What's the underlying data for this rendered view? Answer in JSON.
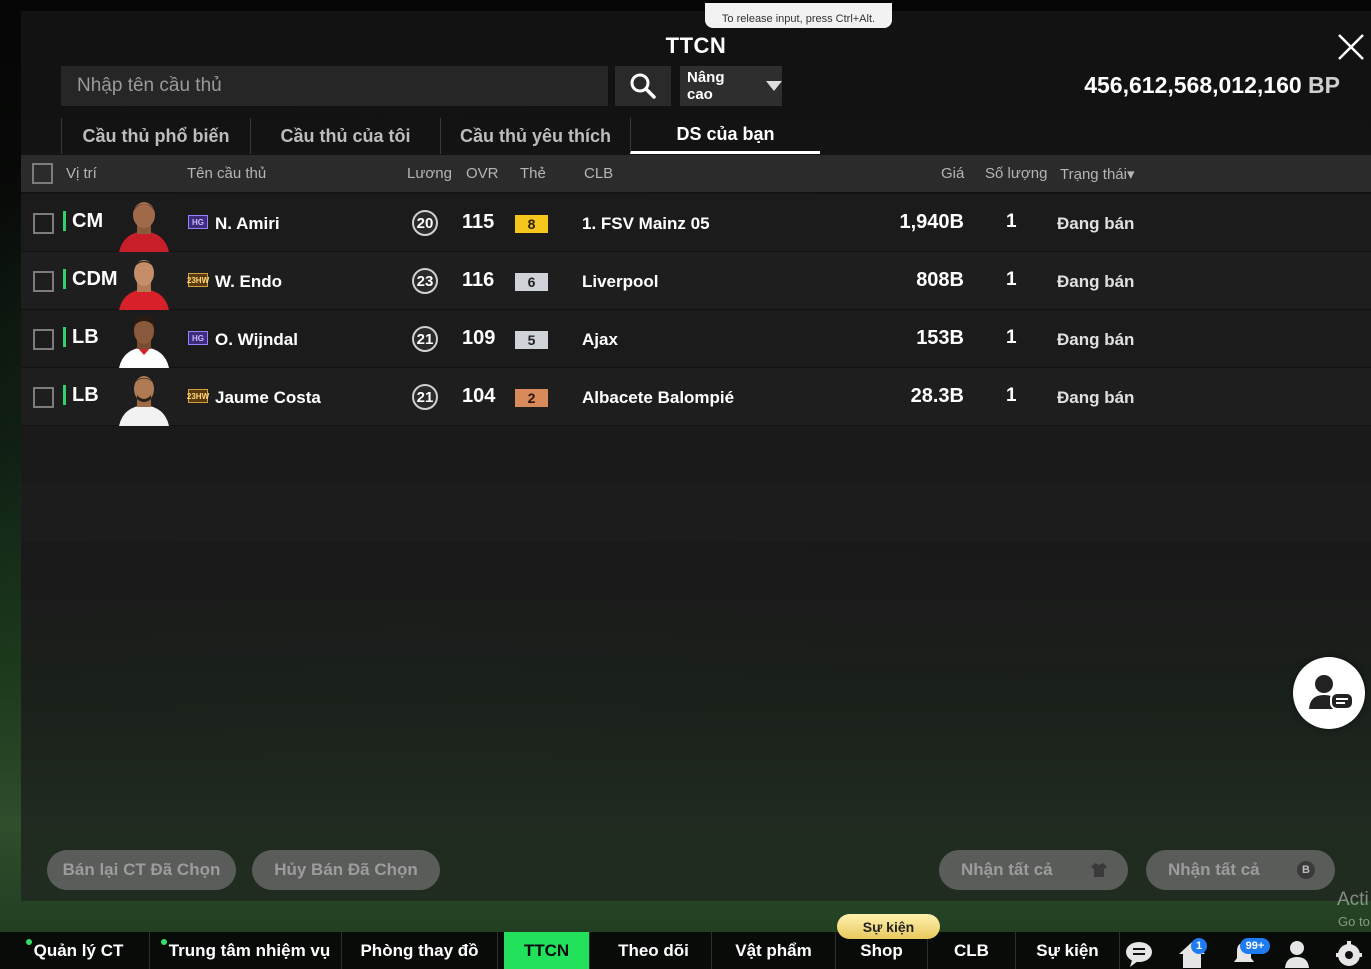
{
  "overlay": {
    "tooltip": "To release input, press Ctrl+Alt."
  },
  "header": {
    "title": "TTCN"
  },
  "search": {
    "placeholder": "Nhập tên cầu thủ",
    "advanced_label": "Nâng cao"
  },
  "currency": {
    "amount": "456,612,568,012,160",
    "unit": "BP"
  },
  "tabs": [
    {
      "label": "Cầu thủ phổ biến"
    },
    {
      "label": "Cầu thủ của tôi"
    },
    {
      "label": "Cầu thủ yêu thích"
    },
    {
      "label": "DS của bạn",
      "active": true
    }
  ],
  "table": {
    "headers": {
      "position": "Vị trí",
      "name": "Tên cầu thủ",
      "salary": "Lương",
      "ovr": "OVR",
      "card": "Thẻ",
      "club": "CLB",
      "price": "Giá",
      "quantity": "Số lượng",
      "status": "Trạng thái▾"
    },
    "rows": [
      {
        "position": "CM",
        "season_badge": "HG",
        "name": "N. Amiri",
        "salary": "20",
        "ovr": "115",
        "upgrade": "8",
        "upgrade_color": "#f5c51c",
        "club": "1. FSV Mainz 05",
        "price": "1,940B",
        "quantity": "1",
        "status": "Đang bán",
        "kit": "#c81e2a"
      },
      {
        "position": "CDM",
        "season_badge": "23HW",
        "name": "W. Endo",
        "salary": "23",
        "ovr": "116",
        "upgrade": "6",
        "upgrade_color": "#cfd3d8",
        "club": "Liverpool",
        "price": "808B",
        "quantity": "1",
        "status": "Đang bán",
        "kit": "#d8202b"
      },
      {
        "position": "LB",
        "season_badge": "HG",
        "name": "O. Wijndal",
        "salary": "21",
        "ovr": "109",
        "upgrade": "5",
        "upgrade_color": "#cfd3d8",
        "club": "Ajax",
        "price": "153B",
        "quantity": "1",
        "status": "Đang bán",
        "kit": "#ffffff"
      },
      {
        "position": "LB",
        "season_badge": "23HW",
        "name": "Jaume Costa",
        "salary": "21",
        "ovr": "104",
        "upgrade": "2",
        "upgrade_color": "#d88a5a",
        "club": "Albacete Balompié",
        "price": "28.3B",
        "quantity": "1",
        "status": "Đang bán",
        "kit": "#f2f2f2"
      }
    ]
  },
  "actions": {
    "resell_selected": "Bán lại CT Đã Chọn",
    "cancel_selected": "Hủy Bán Đã Chọn",
    "claim_all_1": "Nhận tất cả",
    "claim_all_2": "Nhận tất cả"
  },
  "watermark": {
    "line1": "Acti",
    "line2": "Go to"
  },
  "bottom_nav": {
    "event_tag": "Sự kiện",
    "items": [
      {
        "label": "Quản lý CT"
      },
      {
        "label": "Trung tâm nhiệm vụ"
      },
      {
        "label": "Phòng thay đồ"
      },
      {
        "label": "TTCN",
        "active": true
      },
      {
        "label": "Theo dõi"
      },
      {
        "label": "Vật phẩm"
      },
      {
        "label": "Shop"
      },
      {
        "label": "CLB"
      },
      {
        "label": "Sự kiện"
      }
    ],
    "home_badge": "1",
    "notif_badge": "99+"
  }
}
